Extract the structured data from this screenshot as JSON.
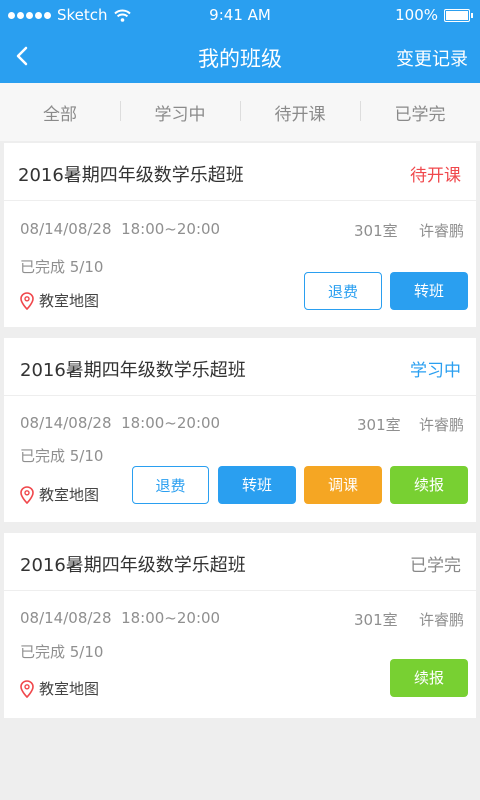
{
  "status_bar": {
    "carrier": "Sketch",
    "time": "9:41 AM",
    "battery": "100%"
  },
  "nav": {
    "title": "我的班级",
    "action": "变更记录",
    "back_icon": "chevron-left-icon"
  },
  "tabs": [
    {
      "label": "全部"
    },
    {
      "label": "学习中"
    },
    {
      "label": "待开课"
    },
    {
      "label": "已学完"
    }
  ],
  "classes": [
    {
      "name": "2016暑期四年级数学乐超班",
      "status": "待开课",
      "status_color": "#f0484c",
      "date": "08/14/08/28",
      "time": "18:00~20:00",
      "room": "301室",
      "teacher": "许睿鹏",
      "progress": "已完成 5/10",
      "map": "教室地图",
      "buttons": {
        "refund": "退费",
        "transfer": "转班"
      }
    },
    {
      "name": "2016暑期四年级数学乐超班",
      "status": "学习中",
      "status_color": "#2a9ff0",
      "date": "08/14/08/28",
      "time": "18:00~20:00",
      "room": "301室",
      "teacher": "许睿鹏",
      "progress": "已完成 5/10",
      "map": "教室地图",
      "buttons": {
        "refund": "退费",
        "transfer": "转班",
        "reschedule": "调课",
        "renew": "续报"
      }
    },
    {
      "name": "2016暑期四年级数学乐超班",
      "status": "已学完",
      "status_color": "#888888",
      "date": "08/14/08/28",
      "time": "18:00~20:00",
      "room": "301室",
      "teacher": "许睿鹏",
      "progress": "已完成 5/10",
      "map": "教室地图",
      "buttons": {
        "renew": "续报"
      }
    }
  ],
  "colors": {
    "primary": "#2a9ff0",
    "orange": "#f5a623",
    "green": "#78d032",
    "red": "#f0484c"
  }
}
